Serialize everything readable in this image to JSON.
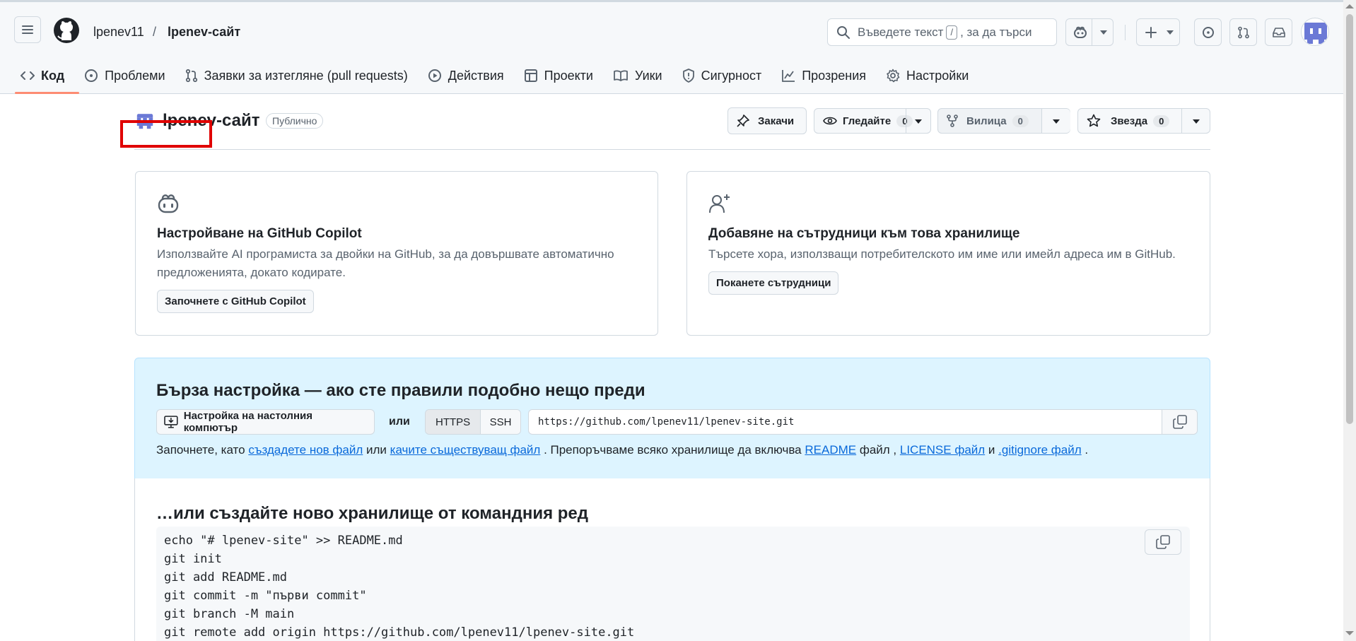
{
  "header": {
    "owner": "lpenev11",
    "separator": "/",
    "repo": "lpenev-сайт",
    "search_placeholder_before": "Въведете текст",
    "search_key": "/",
    "search_placeholder_after": ", за да търси"
  },
  "tabs": [
    {
      "label": "Код",
      "icon": "code-icon"
    },
    {
      "label": "Проблеми",
      "icon": "issue-icon"
    },
    {
      "label": "Заявки за изтегляне (pull requests)",
      "icon": "pull-request-icon"
    },
    {
      "label": "Действия",
      "icon": "play-icon"
    },
    {
      "label": "Проекти",
      "icon": "table-icon"
    },
    {
      "label": "Уики",
      "icon": "book-icon"
    },
    {
      "label": "Сигурност",
      "icon": "shield-icon"
    },
    {
      "label": "Прозрения",
      "icon": "graph-icon"
    },
    {
      "label": "Настройки",
      "icon": "gear-icon"
    }
  ],
  "repo_header": {
    "title": "lpenev-сайт",
    "visibility": "Публично",
    "pin_label": "Закачи",
    "watch_label": "Гледайте",
    "watch_count": "0",
    "fork_label": "Вилица",
    "fork_count": "0",
    "star_label": "Звезда",
    "star_count": "0"
  },
  "cards": {
    "copilot": {
      "title": "Настройване на GitHub Copilot",
      "description": "Използвайте AI програмиста за двойки на GitHub, за да довършвате автоматично предложенията, докато кодирате.",
      "button": "Започнете с GitHub Copilot"
    },
    "collaborators": {
      "title": "Добавяне на сътрудници към това хранилище",
      "description": "Търсете хора, използващи потребителското им име или имейл адреса им в GitHub.",
      "button": "Поканете сътрудници"
    }
  },
  "quick_setup": {
    "title": "Бърза настройка — ако сте правили подобно нещо преди",
    "desktop_button": "Настройка на настолния компютър",
    "or": "или",
    "https": "HTTPS",
    "ssh": "SSH",
    "url": "https://github.com/lpenev11/lpenev-site.git",
    "hint_start": "Започнете, като ",
    "hint_link1": "създадете нов файл",
    "hint_mid1": " или ",
    "hint_link2": "качите съществуващ файл",
    "hint_mid2": " . Препоръчваме всяко хранилище да включва ",
    "hint_link3": "README",
    "hint_mid3": " файл , ",
    "hint_link4": "LICENSE файл",
    "hint_mid4": " и ",
    "hint_link5": ".gitignore файл",
    "hint_end": " ."
  },
  "command_line": {
    "title": "…или създайте ново хранилище от командния ред",
    "lines": [
      "echo \"# lpenev-site\" >> README.md",
      "git init",
      "git add README.md",
      "git commit -m \"първи commit\"",
      "git branch -M main",
      "git remote add origin https://github.com/lpenev11/lpenev-site.git"
    ]
  },
  "colors": {
    "accent_underline": "#fd8c73",
    "link": "#0969da",
    "quick_bg": "#ddf4ff",
    "highlight_box": "#e00000"
  }
}
